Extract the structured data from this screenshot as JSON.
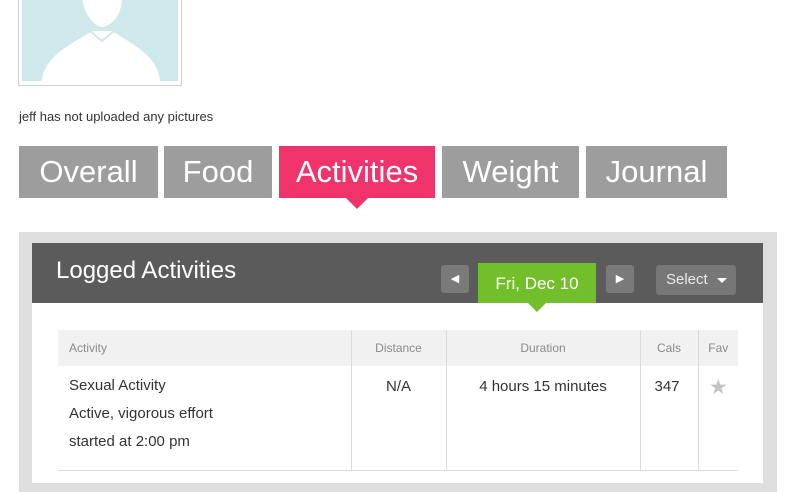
{
  "profile": {
    "no_pictures_text": "jeff has not uploaded any pictures"
  },
  "tabs": [
    {
      "label": "Overall",
      "active": false
    },
    {
      "label": "Food",
      "active": false
    },
    {
      "label": "Activities",
      "active": true
    },
    {
      "label": "Weight",
      "active": false
    },
    {
      "label": "Journal",
      "active": false
    }
  ],
  "panel": {
    "title": "Logged Activities",
    "date": "Fri, Dec 10",
    "prev_icon": "triangle-left-icon",
    "next_icon": "triangle-right-icon",
    "select_label": "Select"
  },
  "table": {
    "columns": [
      "Activity",
      "Distance",
      "Duration",
      "Cals",
      "Fav"
    ],
    "rows": [
      {
        "activity_name": "Sexual Activity",
        "activity_detail": "Active, vigorous effort",
        "activity_start": "started at 2:00 pm",
        "distance": "N/A",
        "duration": "4 hours 15 minutes",
        "cals": "347",
        "fav_icon": "star-icon"
      }
    ]
  },
  "colors": {
    "active_tab": "#f0336b",
    "inactive_tab": "#9d9d9d",
    "date_button": "#73bf2b",
    "panel_header": "#5b5b5b"
  }
}
